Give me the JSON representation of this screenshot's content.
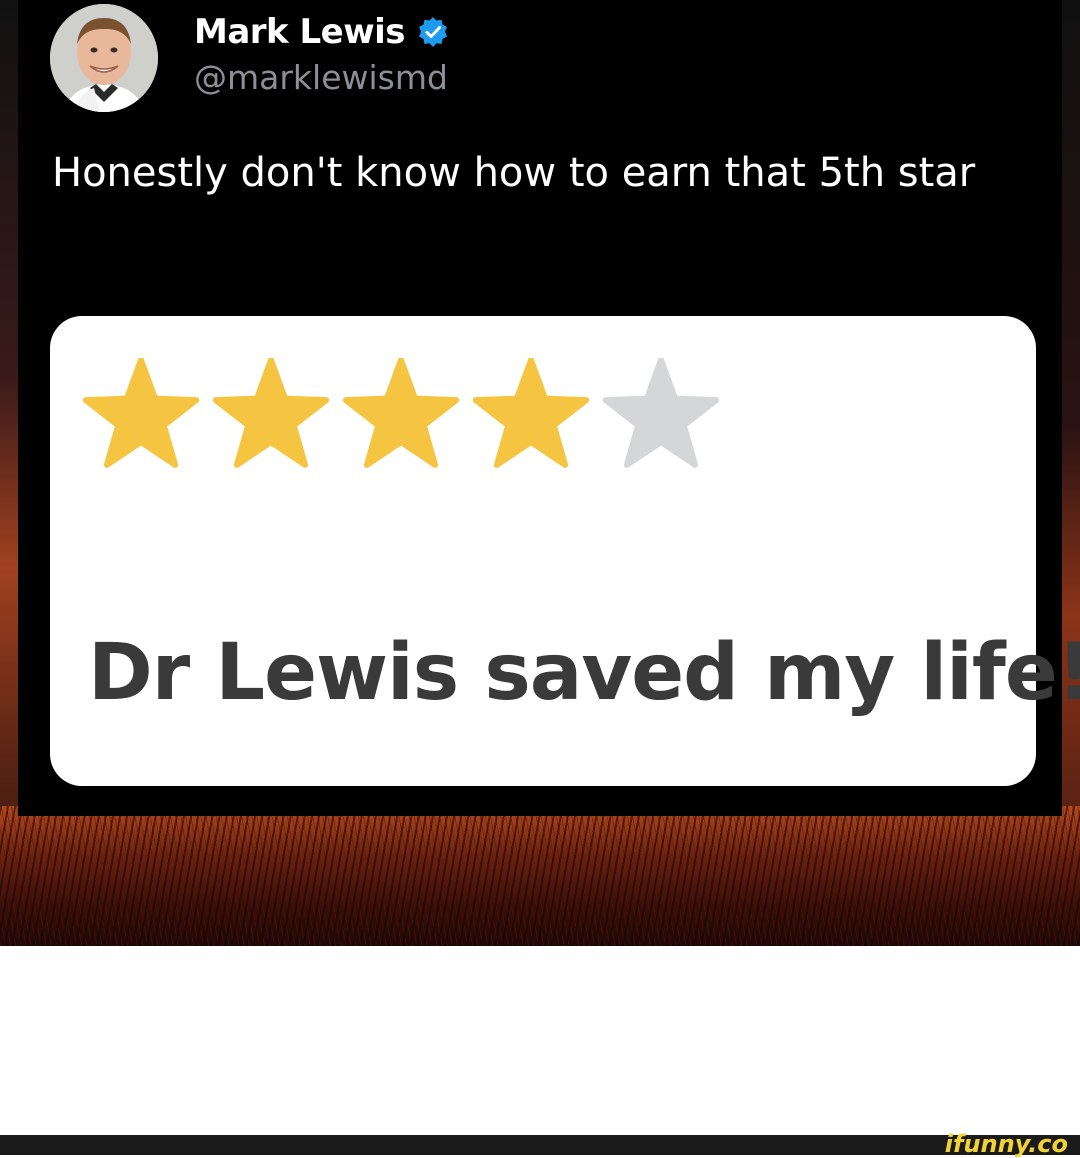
{
  "tweet": {
    "author_name": "Mark Lewis",
    "author_handle": "@marklewismd",
    "text": "Honestly don't know how to earn that 5th star"
  },
  "review_card": {
    "rating": 4,
    "rating_max": 5,
    "review_text": "Dr Lewis saved my life!",
    "star_filled_color": "#f5c542",
    "star_empty_color": "#d4d6d8"
  },
  "watermark": {
    "text": "ifunny.co",
    "color": "#f3d233"
  },
  "icons": {
    "verified": "verified-badge-icon"
  },
  "colors": {
    "tweet_background": "#000000",
    "text_primary": "#ffffff",
    "text_secondary": "#8b9096",
    "verified_blue": "#1d9bf0"
  }
}
